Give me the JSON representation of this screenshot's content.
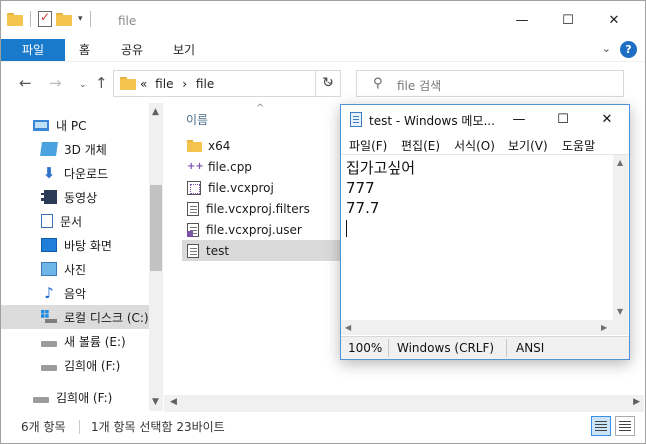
{
  "explorer": {
    "title": "file",
    "window_controls": {
      "minimize": "—",
      "maximize": "☐",
      "close": "✕"
    },
    "ribbon": {
      "file_tab": "파일",
      "tabs": [
        "홈",
        "공유",
        "보기"
      ],
      "help": "?"
    },
    "address": {
      "prefix": "«",
      "path": [
        "file",
        "file"
      ],
      "separator": "›"
    },
    "search": {
      "placeholder": "file 검색"
    },
    "sidebar": {
      "items": [
        {
          "label": "내 PC",
          "icon": "pc-icon"
        },
        {
          "label": "3D 개체",
          "icon": "3d-objects-icon"
        },
        {
          "label": "다운로드",
          "icon": "download-icon"
        },
        {
          "label": "동영상",
          "icon": "video-icon"
        },
        {
          "label": "문서",
          "icon": "document-icon"
        },
        {
          "label": "바탕 화면",
          "icon": "desktop-icon"
        },
        {
          "label": "사진",
          "icon": "picture-icon"
        },
        {
          "label": "음악",
          "icon": "music-icon"
        },
        {
          "label": "로컬 디스크 (C:)",
          "icon": "local-disk-icon",
          "selected": true
        },
        {
          "label": "새 볼륨 (E:)",
          "icon": "drive-icon"
        },
        {
          "label": "김희애 (F:)",
          "icon": "drive-icon"
        },
        {
          "label": "김희애 (F:)",
          "icon": "drive-icon"
        }
      ]
    },
    "filelist": {
      "column_name": "이름",
      "files": [
        {
          "name": "x64",
          "icon": "folder-icon"
        },
        {
          "name": "file.cpp",
          "icon": "cpp-file-icon"
        },
        {
          "name": "file.vcxproj",
          "icon": "vcxproj-file-icon"
        },
        {
          "name": "file.vcxproj.filters",
          "icon": "filters-file-icon"
        },
        {
          "name": "file.vcxproj.user",
          "icon": "user-file-icon"
        },
        {
          "name": "test",
          "icon": "text-file-icon",
          "selected": true
        }
      ]
    },
    "status": {
      "item_count": "6개 항목",
      "selection": "1개 항목 선택함 23바이트"
    }
  },
  "notepad": {
    "title": "test - Windows 메모...",
    "window_controls": {
      "minimize": "—",
      "maximize": "☐",
      "close": "✕"
    },
    "menu": [
      "파일(F)",
      "편집(E)",
      "서식(O)",
      "보기(V)",
      "도움말"
    ],
    "content_lines": [
      "집가고싶어",
      "777",
      "77.7"
    ],
    "status": {
      "zoom": "100%",
      "line_ending": "Windows (CRLF)",
      "encoding": "ANSI"
    }
  }
}
